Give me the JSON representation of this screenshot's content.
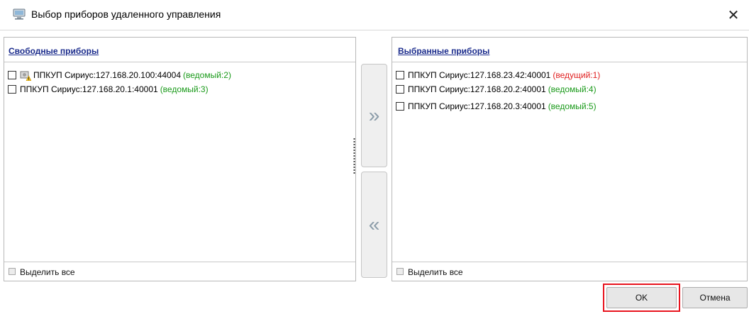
{
  "window": {
    "title": "Выбор приборов удаленного управления",
    "close_glyph": "✕",
    "icon": "computer-icon"
  },
  "left_panel": {
    "title": "Свободные приборы",
    "items": [
      {
        "checked": false,
        "status_icon": "device-warning-icon",
        "name": "ППКУП Сириус:",
        "address": "127.168.20.100:44004",
        "role": "(ведомый:2)",
        "role_type": "slave"
      },
      {
        "checked": false,
        "status_icon": "",
        "name": "ППКУП Сириус:",
        "address": "127.168.20.1:40001",
        "role": "(ведомый:3)",
        "role_type": "slave"
      }
    ],
    "select_all_label": "Выделить все"
  },
  "right_panel": {
    "title": "Выбранные приборы",
    "items": [
      {
        "checked": false,
        "name": "ППКУП Сириус:",
        "address": "127.168.23.42:40001",
        "role": "(ведущий:1)",
        "role_type": "master"
      },
      {
        "checked": false,
        "name": "ППКУП Сириус:",
        "address": "127.168.20.2:40001",
        "role": "(ведомый:4)",
        "role_type": "slave"
      },
      {
        "checked": false,
        "name": "ППКУП Сириус:",
        "address": "127.168.20.3:40001",
        "role": "(ведомый:5)",
        "role_type": "slave"
      }
    ],
    "select_all_label": "Выделить все"
  },
  "transfer": {
    "move_right_glyph": "»",
    "move_left_glyph": "«"
  },
  "buttons": {
    "ok_label": "OK",
    "cancel_label": "Отмена"
  },
  "colors": {
    "panel_title": "#1a2b8c",
    "slave_role": "#1a9a1a",
    "master_role": "#e02020",
    "ok_highlight": "#e8141e"
  }
}
